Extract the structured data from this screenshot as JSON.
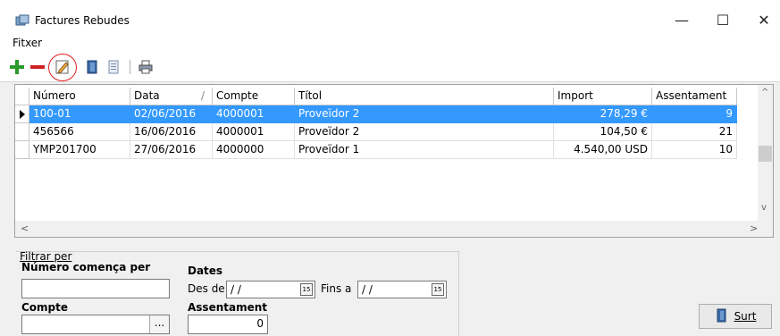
{
  "window": {
    "title": "Factures Rebudes",
    "minimize_glyph": "—",
    "maximize_glyph": "☐",
    "close_glyph": "✕"
  },
  "menu": {
    "fitxer": "Fitxer"
  },
  "toolbar": {
    "buttons": [
      "add-icon",
      "remove-icon",
      "edit-icon",
      "exit-door-icon",
      "document-icon",
      "print-icon"
    ],
    "highlight_color": "#e02020"
  },
  "grid": {
    "columns": [
      "Número",
      "Data",
      "Compte",
      "Títol",
      "Import",
      "Assentament"
    ],
    "sort_marker": "/",
    "rows": [
      {
        "numero": "100-01",
        "data": "02/06/2016",
        "compte": "4000001",
        "titol": "Proveïdor 2",
        "import": "278,29 €",
        "assentament": "9"
      },
      {
        "numero": "456566",
        "data": "16/06/2016",
        "compte": "4000001",
        "titol": "Proveïdor 2",
        "import": "104,50 €",
        "assentament": "21"
      },
      {
        "numero": "YMP201700",
        "data": "27/06/2016",
        "compte": "4000000",
        "titol": "Proveïdor 1",
        "import": "4.540,00 USD",
        "assentament": "10"
      }
    ],
    "selected_color": "#3399ff",
    "scroll_up": "^",
    "scroll_down": "v",
    "scroll_left": "<",
    "scroll_right": ">"
  },
  "filter": {
    "heading": "Filtrar per",
    "numero_label": "Número comença per",
    "numero_value": "",
    "dates_label": "Dates",
    "des_de_label": "Des de",
    "des_de_value": " / /",
    "fins_label": "Fins a",
    "fins_value": " / /",
    "cal_glyph": "15",
    "compte_label": "Compte",
    "compte_value": "",
    "compte_button": "...",
    "assentament_label": "Assentament",
    "assentament_value": "0"
  },
  "footer": {
    "surt_label": "Surt"
  }
}
